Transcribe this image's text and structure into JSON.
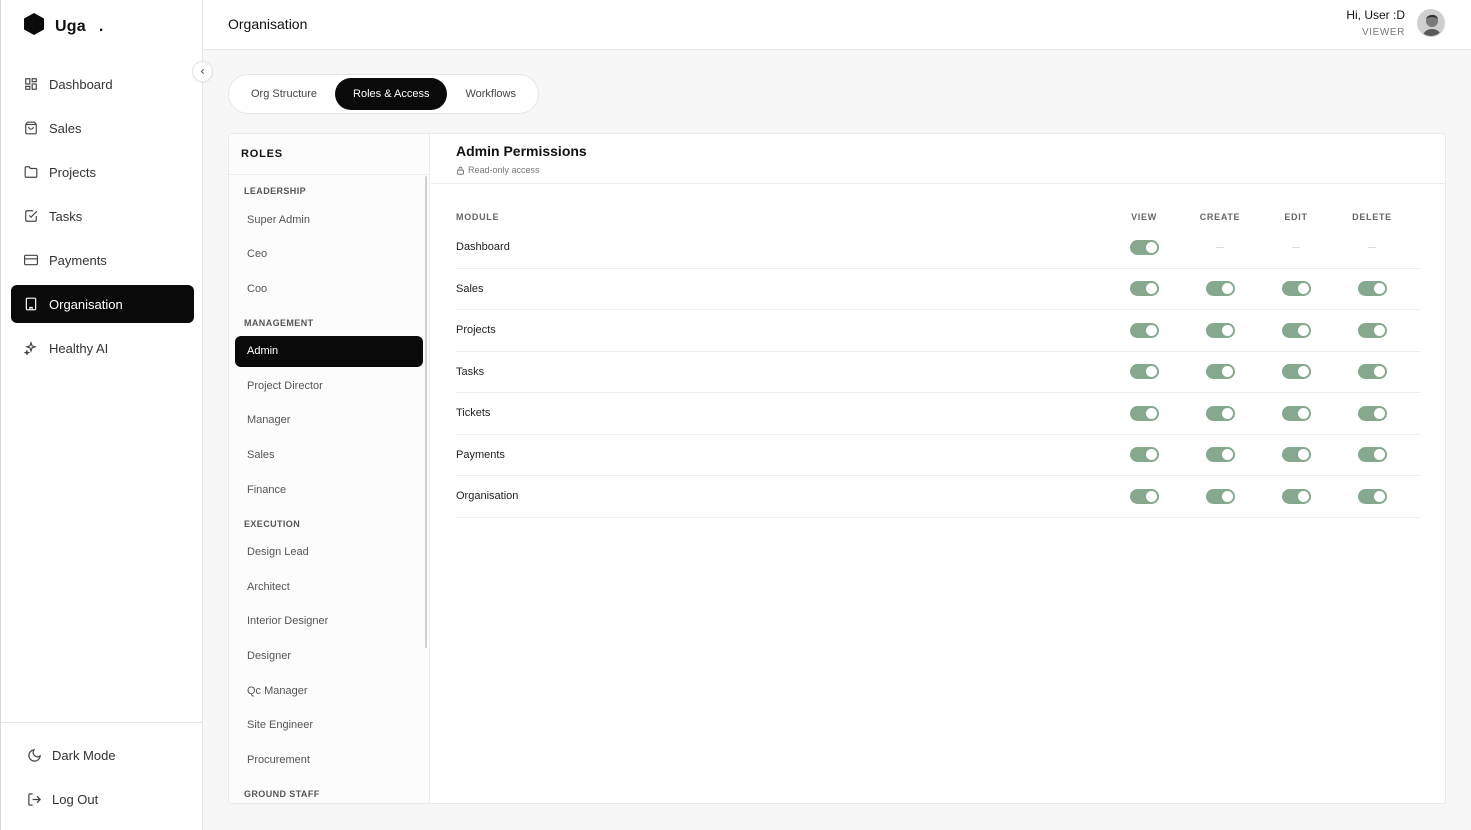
{
  "brand": {
    "name": "Uga",
    "dot": "."
  },
  "nav": [
    {
      "label": "Dashboard",
      "icon": "dashboard-icon"
    },
    {
      "label": "Sales",
      "icon": "shopping-bag-icon"
    },
    {
      "label": "Projects",
      "icon": "folder-icon"
    },
    {
      "label": "Tasks",
      "icon": "checkbox-icon"
    },
    {
      "label": "Payments",
      "icon": "credit-card-icon"
    },
    {
      "label": "Organisation",
      "icon": "building-icon",
      "active": true
    },
    {
      "label": "Healthy AI",
      "icon": "sparkles-icon"
    }
  ],
  "bottom": {
    "dark_mode": "Dark Mode",
    "logout": "Log Out"
  },
  "header": {
    "title": "Organisation",
    "greeting": "Hi, User :D",
    "role": "VIEWER"
  },
  "tabs": [
    "Org Structure",
    "Roles & Access",
    "Workflows"
  ],
  "active_tab": "Roles & Access",
  "roles": {
    "heading": "ROLES",
    "groups": [
      {
        "name": "LEADERSHIP",
        "items": [
          "Super Admin",
          "Ceo",
          "Coo"
        ]
      },
      {
        "name": "MANAGEMENT",
        "items": [
          "Admin",
          "Project Director",
          "Manager",
          "Sales",
          "Finance"
        ]
      },
      {
        "name": "EXECUTION",
        "items": [
          "Design Lead",
          "Architect",
          "Interior Designer",
          "Designer",
          "Qc Manager",
          "Site Engineer",
          "Procurement"
        ]
      },
      {
        "name": "GROUND STAFF",
        "items": []
      }
    ],
    "selected": "Admin"
  },
  "permissions": {
    "title": "Admin Permissions",
    "subtitle": "Read-only access",
    "columns": [
      "MODULE",
      "VIEW",
      "CREATE",
      "EDIT",
      "DELETE"
    ],
    "rows": [
      {
        "module": "Dashboard",
        "view": true,
        "create": null,
        "edit": null,
        "delete": null
      },
      {
        "module": "Sales",
        "view": true,
        "create": true,
        "edit": true,
        "delete": true
      },
      {
        "module": "Projects",
        "view": true,
        "create": true,
        "edit": true,
        "delete": true
      },
      {
        "module": "Tasks",
        "view": true,
        "create": true,
        "edit": true,
        "delete": true
      },
      {
        "module": "Tickets",
        "view": true,
        "create": true,
        "edit": true,
        "delete": true
      },
      {
        "module": "Payments",
        "view": true,
        "create": true,
        "edit": true,
        "delete": true
      },
      {
        "module": "Organisation",
        "view": true,
        "create": true,
        "edit": true,
        "delete": true
      }
    ]
  },
  "colors": {
    "accent": "#0a0a0a",
    "toggle_on": "#86a88e"
  }
}
